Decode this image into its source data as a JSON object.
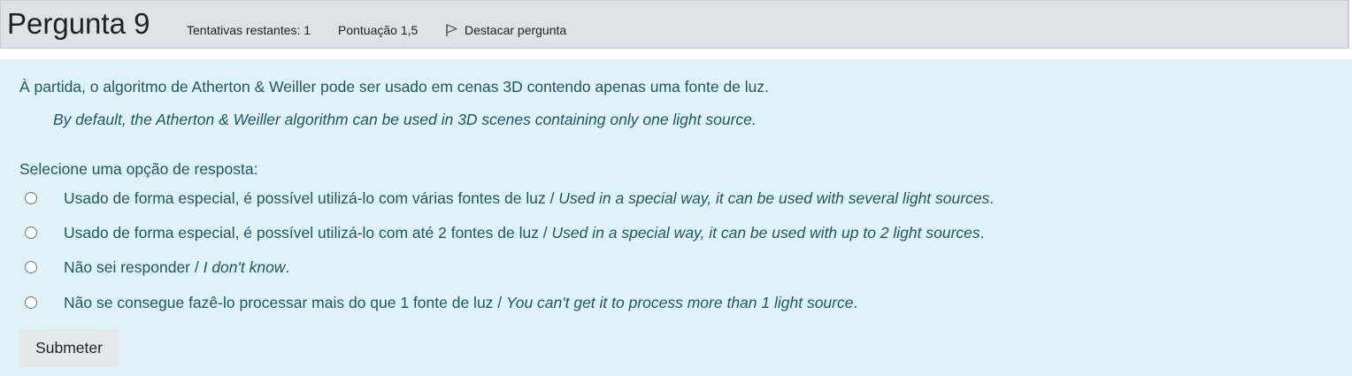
{
  "header": {
    "title": "Pergunta 9",
    "attempts": "Tentativas restantes: 1",
    "score": "Pontuação 1,5",
    "flag_label": "Destacar pergunta",
    "flag_icon": "flag-outline-icon"
  },
  "question": {
    "text_pt": "À partida, o algoritmo de Atherton & Weiller pode ser usado em cenas 3D contendo apenas uma fonte de luz.",
    "text_en": "By default, the Atherton & Weiller algorithm can be used in 3D scenes containing only one light source.",
    "prompt": "Selecione uma opção de resposta:",
    "options": [
      {
        "pt": "Usado de forma especial, é possível utilizá-lo com várias fontes de luz / ",
        "en": "Used in a special way, it can be used with several light sources",
        "end": ".",
        "selected": false
      },
      {
        "pt": "Usado de forma especial, é possível utilizá-lo com até 2 fontes de luz / ",
        "en": "Used in a special way, it can be used with up to 2 light sources",
        "end": ".",
        "selected": false
      },
      {
        "pt": "Não sei responder / ",
        "en": "I don't know",
        "end": ".",
        "selected": false
      },
      {
        "pt": "Não se consegue fazê-lo processar mais do que 1 fonte de luz / ",
        "en": "You can't get it to process more than 1 light source",
        "end": ".",
        "selected": false
      }
    ],
    "submit_label": "Submeter"
  },
  "colors": {
    "header_bg": "#dee2e6",
    "content_bg": "#def2f8",
    "content_text": "#1f5665",
    "button_bg": "#e5e8eb"
  }
}
